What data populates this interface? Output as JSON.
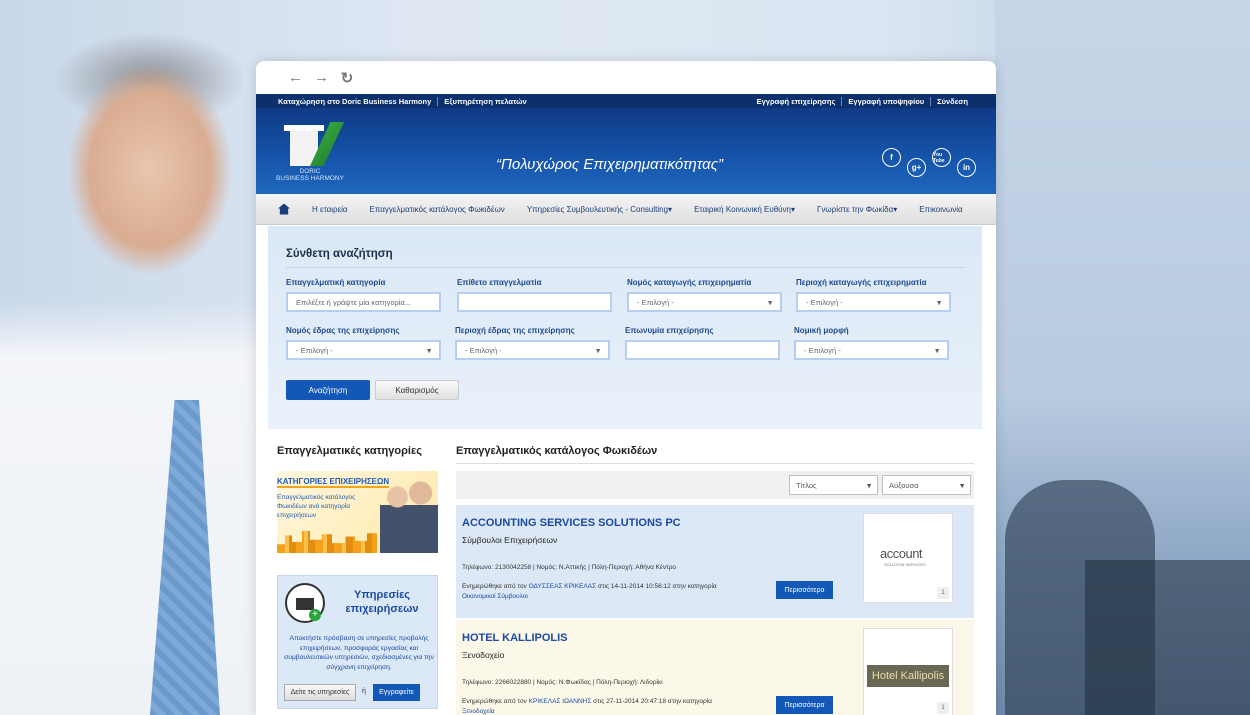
{
  "topbar": {
    "left": [
      "Καταχώρηση στο Doric Business Harmony",
      "Εξυπηρέτηση πελατών"
    ],
    "right": [
      "Εγγραφή επιχείρησης",
      "Εγγραφή υποψηφίου",
      "Σύνδεση"
    ]
  },
  "header": {
    "logo_line1": "DORIC",
    "logo_line2": "BUSINESS HARMONY",
    "slogan": "“Πολυχώρος Επιχειρηματικότητας”",
    "social": [
      "f",
      "g+",
      "You Tube",
      "in"
    ]
  },
  "nav": [
    "Η εταιρεία",
    "Επαγγελματικός κατάλογος Φωκιδέων",
    "Υπηρεσίες Συμβουλευτικής - Consulting▾",
    "Εταιρική Κοινωνική Ευθύνη▾",
    "Γνωρίστε την Φωκίδα▾",
    "Επικοινωνία"
  ],
  "search": {
    "title": "Σύνθετη αναζήτηση",
    "fields": [
      {
        "label": "Επαγγελματική κατηγορία",
        "placeholder": "Επιλέξτε ή γράψτε μία κατηγορία..."
      },
      {
        "label": "Επίθετο επαγγελματία",
        "placeholder": ""
      },
      {
        "label": "Νομός καταγωγής επιχειρηματία",
        "placeholder": "- Επιλογή -"
      },
      {
        "label": "Περιοχή καταγωγής επιχειρηματία",
        "placeholder": "- Επιλογή -"
      },
      {
        "label": "Νομός έδρας της επιχείρησης",
        "placeholder": "- Επιλογή -"
      },
      {
        "label": "Περιοχή έδρας της επιχείρησης",
        "placeholder": "- Επιλογή -"
      },
      {
        "label": "Επωνυμία επιχείρησης",
        "placeholder": ""
      },
      {
        "label": "Νομική μορφή",
        "placeholder": "- Επιλογή -"
      }
    ],
    "search_btn": "Αναζήτηση",
    "clear_btn": "Καθαρισμός"
  },
  "left": {
    "title": "Επαγγελματικές κατηγορίες",
    "banner_title": "ΚΑΤΗΓΟΡΙΕΣ ΕΠΙΧΕΙΡΗΣΕΩΝ",
    "banner_text": "Επαγγελματικός κατάλογος Φωκιδέων ανά κατηγορία επιχειρήσεων",
    "services_title": "Υπηρεσίες επιχειρήσεων",
    "services_text": "Αποκτήστε πρόσβαση σε υπηρεσίες προβολής επιχειρήσεων, προσφοράς εργασίας και συμβουλευτικών υπηρεσιών, σχεδιασμένες για την σύγχρονη επιχείρηση.",
    "see_services": "Δείτε τις υπηρεσίες",
    "or": "ή",
    "register": "Εγγραφείτε"
  },
  "main": {
    "title": "Επαγγελματικός κατάλογος Φωκιδέων",
    "sort_field": "Τίτλος",
    "sort_order": "Αύξουσα",
    "listings": [
      {
        "name": "ACCOUNTING SERVICES SOLUTIONS PC",
        "category": "Σύμβουλοι Επιχειρήσεων",
        "info": "Τηλέφωνο: 2130042258 | Νομός: Ν.Αττικής | Πόλη-Περιοχή: Αθήνα Κέντρο",
        "updated_pre": "Ενημερώθηκε από τον ",
        "updated_by": "ΟΔΥΣΣΕΑΣ ΚΡΙΚΕΛΑΣ",
        "updated_mid": " στις 14-11-2014 10:56:12 στην κατηγορία ",
        "updated_cat": "Οικονομικοί Σύμβουλοι",
        "more": "Περισσότερα",
        "logo_main": "account",
        "logo_sub": "SOLUTION SERVICES",
        "badge": "1"
      },
      {
        "name": "HOTEL KALLIPOLIS",
        "category": "Ξενοδοχείο",
        "info": "Τηλέφωνο: 2266022880 | Νομός: Ν.Φωκίδας | Πόλη-Περιοχή: Λιδορίκι",
        "updated_pre": "Ενημερώθηκε από τον ",
        "updated_by": "ΚΡΙΚΕΛΑΣ ΙΩΑΝΝΗΣ",
        "updated_mid": " στις 27-11-2014 20:47:18 στην κατηγορία ",
        "updated_cat": "Ξενοδοχεία",
        "more": "Περισσότερα",
        "logo_main": "Hotel Kallipolis",
        "badge": "1"
      }
    ]
  }
}
